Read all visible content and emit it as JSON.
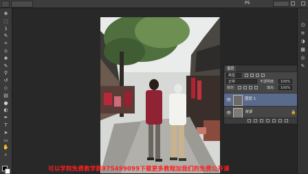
{
  "app": {
    "title": "PS",
    "icons": [
      "search-icon",
      "layout-icon",
      "expand-icon"
    ]
  },
  "tools": {
    "icons": [
      "move-icon",
      "marquee-icon",
      "lasso-icon",
      "quick-select-icon",
      "crop-icon",
      "eyedropper-icon",
      "healing-icon",
      "brush-icon",
      "stamp-icon",
      "history-brush-icon",
      "eraser-icon",
      "gradient-icon",
      "blur-icon",
      "dodge-icon",
      "pen-icon",
      "type-icon",
      "path-select-icon",
      "shape-icon",
      "hand-icon",
      "zoom-icon"
    ],
    "glyphs": [
      "✥",
      "⬚",
      "ʖ",
      "✎",
      "⌗",
      "⦸",
      "✚",
      "✎",
      "⚲",
      "↺",
      "◇",
      "▤",
      "●",
      "◐",
      "✒",
      "T",
      "➤",
      "▭",
      "✋",
      "⌕"
    ]
  },
  "watermark": {
    "text": "可以学院免费教学群975499099下载更多教程加我们的免费公开课"
  },
  "layers_panel": {
    "tab_label": "图层",
    "filter_label": "类型",
    "blend_mode": "正常",
    "opacity_label": "不透明度:",
    "opacity_value": "100%",
    "lock_label": "锁定:",
    "fill_label": "填充:",
    "fill_value": "100%",
    "layers": [
      {
        "name": "图层 1",
        "visible": true,
        "selected": true,
        "locked": false
      },
      {
        "name": "背景",
        "visible": true,
        "selected": false,
        "locked": true
      }
    ],
    "footer_icons": [
      "link-icon",
      "fx-icon",
      "mask-icon",
      "adjustment-icon",
      "group-icon",
      "new-layer-icon",
      "trash-icon"
    ]
  },
  "dock": {
    "icons": [
      "history-icon",
      "properties-icon",
      "adjust-icon",
      "layers-icon",
      "channels-icon",
      "paths-icon"
    ],
    "glyphs": [
      "◷",
      "≡",
      "◑",
      "▦",
      "◎",
      "✎"
    ]
  },
  "colors": {
    "accent_selected": "#5a6a8c",
    "watermark": "#ff1e1e",
    "panel_bg": "#464646",
    "workspace_bg": "#262626"
  }
}
